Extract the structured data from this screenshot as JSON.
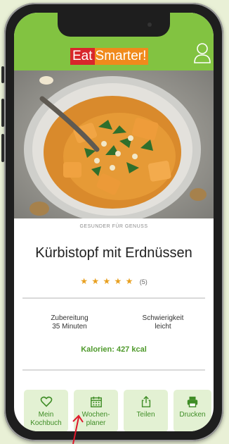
{
  "app": {
    "logo_eat": "Eat",
    "logo_smarter": "Smarter!"
  },
  "recipe": {
    "kicker": "GESUNDER FÜR GENUSS",
    "title": "Kürbistopf mit Erdnüssen",
    "rating_stars": 5,
    "rating_count": "(5)",
    "prep_label": "Zubereitung",
    "prep_value": "35 Minuten",
    "difficulty_label": "Schwierigkeit",
    "difficulty_value": "leicht",
    "calories": "Kalorien: 427 kcal"
  },
  "bottom_nav": {
    "items": [
      {
        "label_1": "Mein",
        "label_2": "Kochbuch",
        "icon": "heart-icon"
      },
      {
        "label_1": "Wochen-",
        "label_2": "planer",
        "icon": "calendar-icon"
      },
      {
        "label_1": "Teilen",
        "label_2": "",
        "icon": "share-icon"
      },
      {
        "label_1": "Drucken",
        "label_2": "",
        "icon": "printer-icon"
      }
    ]
  },
  "colors": {
    "header_green": "#82c341",
    "accent_green": "#3f8d26",
    "tab_bg": "#e3f1d3",
    "logo_red": "#d8262b",
    "logo_orange": "#f08a1c",
    "star": "#e8a020",
    "annotation_arrow": "#e0182c"
  }
}
